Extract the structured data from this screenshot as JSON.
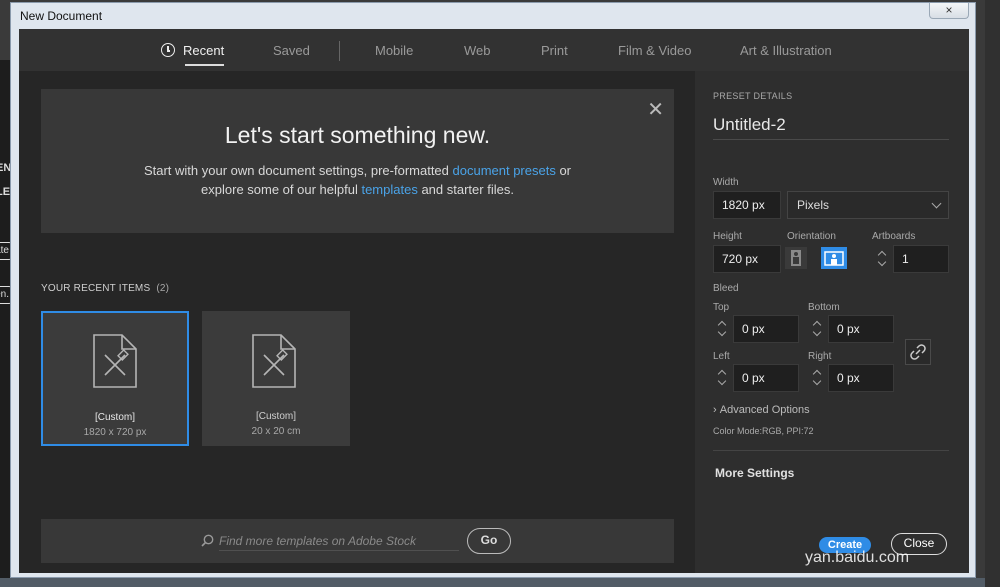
{
  "window": {
    "title": "New Document",
    "close_glyph": "×"
  },
  "tabs": [
    {
      "label": "Recent",
      "active": true,
      "icon": "clock-icon"
    },
    {
      "label": "Saved"
    },
    {
      "label": "Mobile"
    },
    {
      "label": "Web"
    },
    {
      "label": "Print"
    },
    {
      "label": "Film & Video"
    },
    {
      "label": "Art & Illustration"
    }
  ],
  "hero": {
    "title": "Let's start something new.",
    "line1_pre": "Start with your own document settings, pre-formatted ",
    "line1_link": "document presets",
    "line1_post": " or",
    "line2_pre": "explore some of our helpful ",
    "line2_link": "templates",
    "line2_post": " and starter files.",
    "close_glyph": "✕"
  },
  "recent": {
    "label": "YOUR RECENT ITEMS",
    "count": "(2)",
    "items": [
      {
        "name": "[Custom]",
        "dims": "1820 x 720 px"
      },
      {
        "name": "[Custom]",
        "dims": "20 x 20 cm"
      }
    ]
  },
  "search": {
    "placeholder": "Find more templates on Adobe Stock",
    "go_label": "Go"
  },
  "preset": {
    "heading": "PRESET DETAILS",
    "name": "Untitled-2",
    "width_label": "Width",
    "width_value": "1820 px",
    "units": "Pixels",
    "height_label": "Height",
    "height_value": "720 px",
    "orientation_label": "Orientation",
    "artboards_label": "Artboards",
    "artboards_value": "1",
    "bleed_label": "Bleed",
    "top_label": "Top",
    "top_value": "0 px",
    "bottom_label": "Bottom",
    "bottom_value": "0 px",
    "left_label": "Left",
    "left_value": "0 px",
    "right_label": "Right",
    "right_value": "0 px",
    "advanced_label": "Advanced Options",
    "color_mode": "Color Mode:RGB, PPI:72",
    "more_settings": "More Settings",
    "create_label": "Create",
    "close_label": "Close"
  },
  "background": {
    "frag1": "ENT",
    "frag2": "LE",
    "frag3": "ate",
    "frag4": "en."
  },
  "watermark": "yan.baidu.com",
  "colors": {
    "accent": "#2f8ce6",
    "link": "#4aa3e8",
    "panel": "#2e2e2e",
    "main": "#262626"
  }
}
